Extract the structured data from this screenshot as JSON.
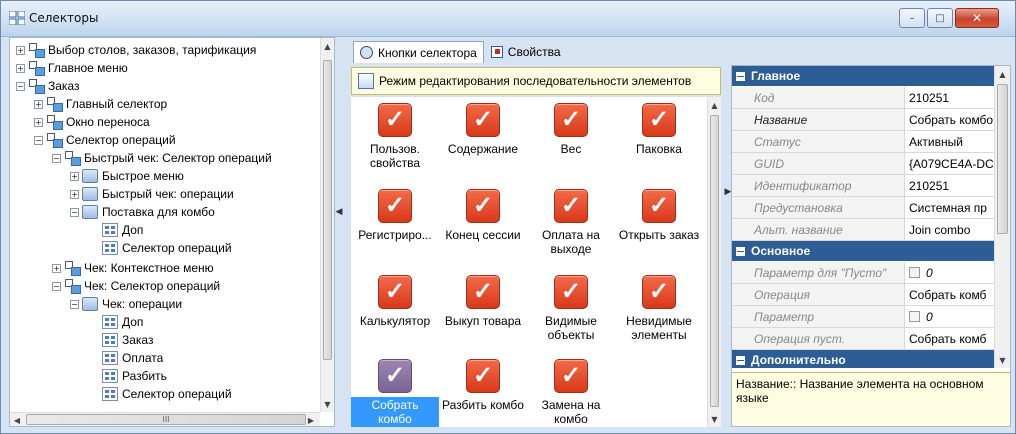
{
  "window": {
    "title": "Селекторы",
    "min_label": "–",
    "max_label": "□",
    "close_label": "✕"
  },
  "tree": {
    "nodes": [
      {
        "label": "Выбор столов, заказов, тарификация",
        "expander": "+",
        "icon": "group-icon"
      },
      {
        "label": "Главное меню",
        "expander": "+",
        "icon": "group-icon"
      },
      {
        "label": "Заказ",
        "expander": "−",
        "icon": "group-icon"
      },
      {
        "label": "Главный селектор",
        "expander": "+",
        "icon": "group-icon"
      },
      {
        "label": "Окно переноса",
        "expander": "+",
        "icon": "group-icon"
      },
      {
        "label": "Селектор операций",
        "expander": "−",
        "icon": "group-icon"
      },
      {
        "label": "Быстрый чек: Селектор операций",
        "expander": "−",
        "icon": "group-icon"
      },
      {
        "label": "Быстрое меню",
        "expander": "+",
        "icon": "folder-icon"
      },
      {
        "label": "Быстрый чек: операции",
        "expander": "+",
        "icon": "folder-icon"
      },
      {
        "label": "Поставка для комбо",
        "expander": "−",
        "icon": "folder-icon"
      },
      {
        "label": "Доп",
        "expander": "",
        "icon": "selector-icon"
      },
      {
        "label": "Селектор операций",
        "expander": "",
        "icon": "selector-icon"
      },
      {
        "label": "Чек: Контекстное меню",
        "expander": "+",
        "icon": "group-icon"
      },
      {
        "label": "Чек: Селектор операций",
        "expander": "−",
        "icon": "group-icon"
      },
      {
        "label": "Чек: операции",
        "expander": "−",
        "icon": "folder-icon"
      },
      {
        "label": "Доп",
        "expander": "",
        "icon": "selector-icon"
      },
      {
        "label": "Заказ",
        "expander": "",
        "icon": "selector-icon"
      },
      {
        "label": "Оплата",
        "expander": "",
        "icon": "selector-icon"
      },
      {
        "label": "Разбить",
        "expander": "",
        "icon": "selector-icon"
      },
      {
        "label": "Селектор операций",
        "expander": "",
        "icon": "selector-icon"
      }
    ],
    "hscroll_thumb": "III"
  },
  "tabs": [
    {
      "label": "Кнопки селектора",
      "active": true
    },
    {
      "label": "Свойства",
      "active": false
    }
  ],
  "mode_text": "Режим редактирования последовательности элементов",
  "buttons": [
    {
      "label": "Пользов. свойства"
    },
    {
      "label": "Содержание"
    },
    {
      "label": "Вес"
    },
    {
      "label": "Паковка"
    },
    {
      "label": "Регистриро..."
    },
    {
      "label": "Конец сессии"
    },
    {
      "label": "Оплата на выходе"
    },
    {
      "label": "Открыть заказ"
    },
    {
      "label": "Калькулятор"
    },
    {
      "label": "Выкуп товара"
    },
    {
      "label": "Видимые объекты"
    },
    {
      "label": "Невидимые элементы"
    },
    {
      "label": "Собрать комбо",
      "selected": true
    },
    {
      "label": "Разбить комбо"
    },
    {
      "label": "Замена на комбо"
    }
  ],
  "checkmark": "✓",
  "properties": {
    "categories": [
      {
        "label": "Главное",
        "rows": [
          {
            "key": "Код",
            "value": "210251"
          },
          {
            "key": "Название",
            "value": "Собрать комбо",
            "bold": true
          },
          {
            "key": "Статус",
            "value": "Активный"
          },
          {
            "key": "GUID",
            "value": "{A079CE4A-DC"
          },
          {
            "key": "Идентификатор",
            "value": "210251"
          },
          {
            "key": "Предустановка",
            "value": "Системная пр"
          },
          {
            "key": "Альт. название",
            "value": "Join combo"
          }
        ]
      },
      {
        "label": "Основное",
        "rows": [
          {
            "key": "Параметр для \"Пусто\"",
            "value": "0",
            "checkbox": true
          },
          {
            "key": "Операция",
            "value": "Собрать комб"
          },
          {
            "key": "Параметр",
            "value": "0",
            "checkbox": true
          },
          {
            "key": "Операция пуст.",
            "value": "Собрать комб"
          }
        ]
      },
      {
        "label": "Дополнительно",
        "rows": []
      }
    ],
    "description": "Название:: Название элемента на основном языке"
  }
}
